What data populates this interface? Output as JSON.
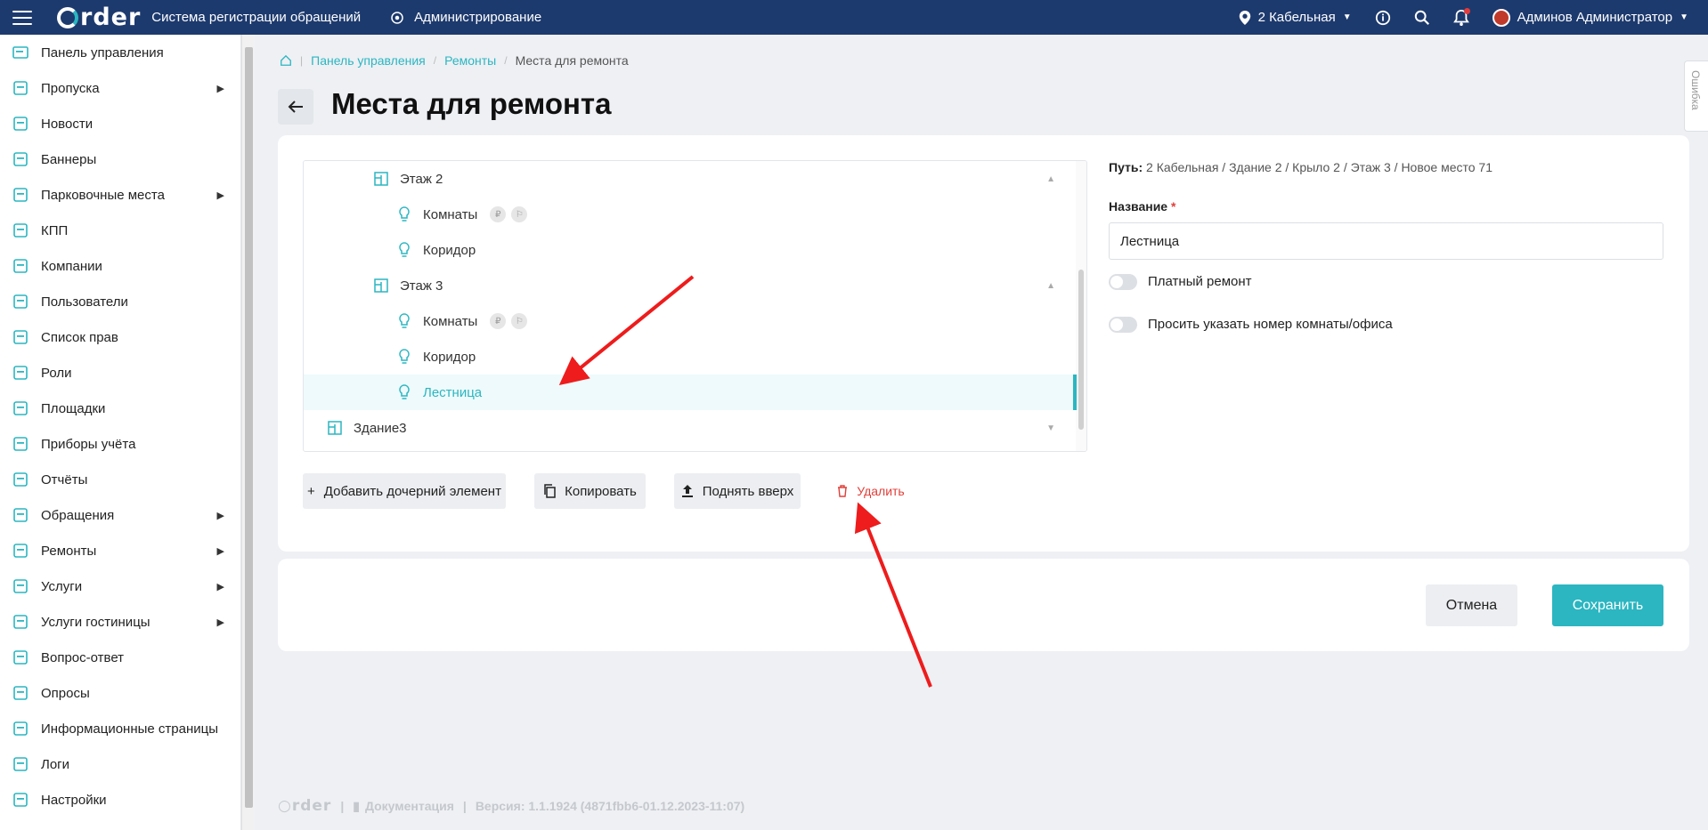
{
  "header": {
    "logo_text": "rder",
    "app_title": "Система регистрации обращений",
    "admin_label": "Администрирование",
    "location": "2 Кабельная",
    "user": "Админов Администратор"
  },
  "sidebar": {
    "items": [
      {
        "label": "Панель управления",
        "icon": "dashboard-icon",
        "submenu": false
      },
      {
        "label": "Пропуска",
        "icon": "pass-icon",
        "submenu": true
      },
      {
        "label": "Новости",
        "icon": "news-icon",
        "submenu": false
      },
      {
        "label": "Баннеры",
        "icon": "banner-icon",
        "submenu": false
      },
      {
        "label": "Парковочные места",
        "icon": "car-icon",
        "submenu": true
      },
      {
        "label": "КПП",
        "icon": "checkpoint-icon",
        "submenu": false
      },
      {
        "label": "Компании",
        "icon": "company-icon",
        "submenu": false
      },
      {
        "label": "Пользователи",
        "icon": "users-icon",
        "submenu": false
      },
      {
        "label": "Список прав",
        "icon": "key-icon",
        "submenu": false
      },
      {
        "label": "Роли",
        "icon": "person-icon",
        "submenu": false
      },
      {
        "label": "Площадки",
        "icon": "location-icon",
        "submenu": false
      },
      {
        "label": "Приборы учёта",
        "icon": "meter-icon",
        "submenu": false
      },
      {
        "label": "Отчёты",
        "icon": "report-icon",
        "submenu": false
      },
      {
        "label": "Обращения",
        "icon": "book-icon",
        "submenu": true
      },
      {
        "label": "Ремонты",
        "icon": "wrench-icon",
        "submenu": true
      },
      {
        "label": "Услуги",
        "icon": "briefcase-icon",
        "submenu": true
      },
      {
        "label": "Услуги гостиницы",
        "icon": "hotel-icon",
        "submenu": true
      },
      {
        "label": "Вопрос-ответ",
        "icon": "faq-icon",
        "submenu": false
      },
      {
        "label": "Опросы",
        "icon": "poll-icon",
        "submenu": false
      },
      {
        "label": "Информационные страницы",
        "icon": "info-pages-icon",
        "submenu": false
      },
      {
        "label": "Логи",
        "icon": "log-icon",
        "submenu": false
      },
      {
        "label": "Настройки",
        "icon": "settings-icon",
        "submenu": false
      }
    ]
  },
  "breadcrumb": {
    "items": [
      "Панель управления",
      "Ремонты"
    ],
    "current": "Места для ремонта"
  },
  "page": {
    "title": "Места для ремонта"
  },
  "tree": {
    "rows": [
      {
        "label": "Этаж 2",
        "type": "floor",
        "level": 2,
        "expanded": true
      },
      {
        "label": "Комнаты",
        "type": "place",
        "level": 3,
        "badges": [
          "₽",
          "⚐"
        ]
      },
      {
        "label": "Коридор",
        "type": "place",
        "level": 3
      },
      {
        "label": "Этаж 3",
        "type": "floor",
        "level": 2,
        "expanded": true
      },
      {
        "label": "Комнаты",
        "type": "place",
        "level": 3,
        "badges": [
          "₽",
          "⚐"
        ]
      },
      {
        "label": "Коридор",
        "type": "place",
        "level": 3
      },
      {
        "label": "Лестница",
        "type": "place",
        "level": 3,
        "selected": true
      },
      {
        "label": "Здание3",
        "type": "floor",
        "level": 1,
        "expanded": false
      }
    ]
  },
  "actions": {
    "add_child": "Добавить дочерний элемент",
    "copy": "Копировать",
    "move_up": "Поднять вверх",
    "delete": "Удалить"
  },
  "details": {
    "path_label": "Путь:",
    "path_value": "2 Кабельная / Здание 2 / Крыло 2 / Этаж 3 / Новое место 71",
    "name_label": "Название",
    "name_required": "*",
    "name_value": "Лестница",
    "paid_repair_label": "Платный ремонт",
    "paid_repair_on": false,
    "ask_room_label": "Просить указать номер комнаты/офиса",
    "ask_room_on": false
  },
  "form_actions": {
    "cancel": "Отмена",
    "save": "Сохранить"
  },
  "footer": {
    "logo": "rder",
    "docs": "Документация",
    "version": "Версия: 1.1.1924 (4871fbb6-01.12.2023-11:07)"
  },
  "feedback_tab": "Ошибка",
  "colors": {
    "header_bg": "#1d3a6e",
    "accent": "#2bb6c1",
    "danger": "#e0403a",
    "annotation_arrow": "#ee1c1c"
  }
}
